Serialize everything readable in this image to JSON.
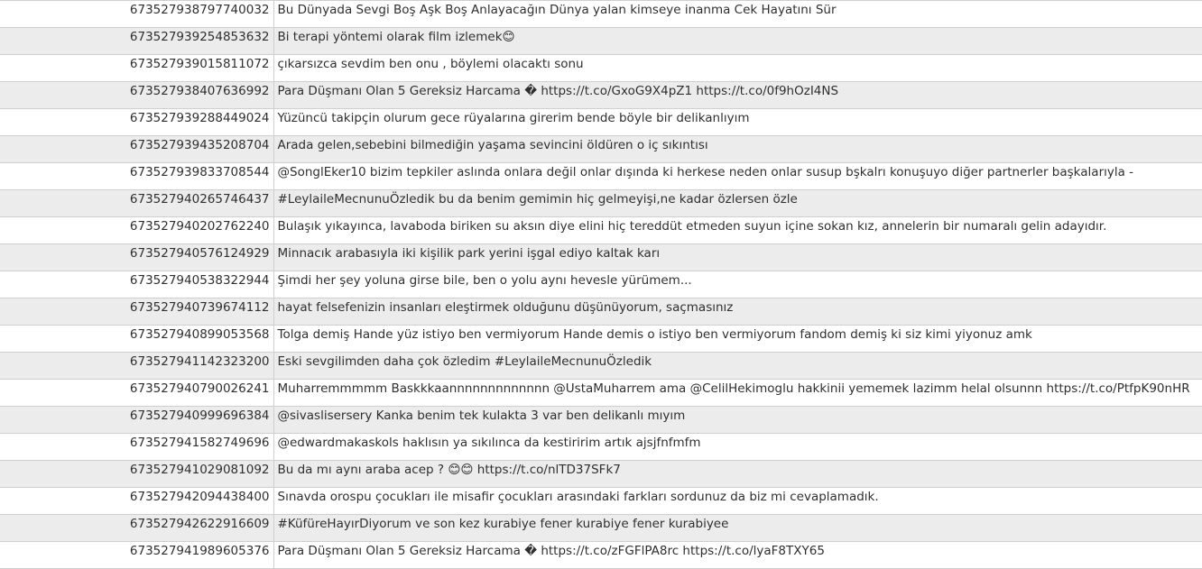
{
  "rows": [
    {
      "id": "673527938797740032",
      "text": "Bu Dünyada Sevgi Boş Aşk Boş Anlayacağın Dünya yalan kimseye inanma Cek Hayatını Sür"
    },
    {
      "id": "673527939254853632",
      "text": "Bi terapi yöntemi olarak film izlemek😊"
    },
    {
      "id": "673527939015811072",
      "text": "çıkarsızca sevdim ben onu , böylemi olacaktı sonu"
    },
    {
      "id": "673527938407636992",
      "text": "Para Düşmanı Olan 5 Gereksiz Harcama  � https://t.co/GxoG9X4pZ1 https://t.co/0f9hOzI4NS"
    },
    {
      "id": "673527939288449024",
      "text": "Yüzüncü takipçin olurum gece rüyalarına girerim  bende böyle bir delikanlıyım"
    },
    {
      "id": "673527939435208704",
      "text": "Arada gelen,sebebini bilmediğin yaşama sevincini öldüren o iç sıkıntısı"
    },
    {
      "id": "673527939833708544",
      "text": "@SonglEker10 bizim tepkiler aslında onlara değil onlar dışında ki herkese neden onlar susup bşkalrı konuşuyo diğer partnerler başkalarıyla -"
    },
    {
      "id": "673527940265746437",
      "text": "#LeylaileMecnunuÖzledik bu da benim gemimin hiç gelmeyişi,ne kadar özlersen özle"
    },
    {
      "id": "673527940202762240",
      "text": "Bulaşık yıkayınca, lavaboda biriken su aksın diye elini hiç tereddüt etmeden suyun içine sokan kız, annelerin bir numaralı gelin adayıdır."
    },
    {
      "id": "673527940576124929",
      "text": "Minnacık arabasıyla iki kişilik park yerini işgal ediyo kaltak karı"
    },
    {
      "id": "673527940538322944",
      "text": "Şimdi her şey yoluna girse bile, ben o yolu aynı hevesle yürümem..."
    },
    {
      "id": "673527940739674112",
      "text": "hayat felsefenizin insanları eleştirmek olduğunu düşünüyorum, saçmasınız"
    },
    {
      "id": "673527940899053568",
      "text": "Tolga demiş Hande yüz istiyo ben vermiyorum Hande demis o istiyo ben vermiyorum fandom demiş ki siz kimi yiyonuz amk"
    },
    {
      "id": "673527941142323200",
      "text": "Eski sevgilimden daha çok özledim #LeylaileMecnunuÖzledik"
    },
    {
      "id": "673527940790026241",
      "text": "Muharremmmmm Baskkkaannnnnnnnnnnnn @UstaMuharrem   ama @CelilHekimoglu  hakkinii yememek lazimm helal olsunnn https://t.co/PtfpK90nHR"
    },
    {
      "id": "673527940999696384",
      "text": "@sivaslisersery Kanka benim tek kulakta 3 var ben delikanlı mıyım"
    },
    {
      "id": "673527941582749696",
      "text": "@edwardmakaskols haklısın ya sıkılınca da kestiririm artık ajsjfnfmfm"
    },
    {
      "id": "673527941029081092",
      "text": "Bu da mı aynı araba acep ? 😊😊 https://t.co/nlTD37SFk7"
    },
    {
      "id": "673527942094438400",
      "text": "Sınavda orospu çocukları ile misafir çocukları arasındaki farkları sordunuz da biz mi cevaplamadık."
    },
    {
      "id": "673527942622916609",
      "text": "#KüfüreHayırDiyorum ve son kez kurabiye fener kurabiye fener kurabiyee"
    },
    {
      "id": "673527941989605376",
      "text": "Para Düşmanı Olan 5 Gereksiz Harcama  � https://t.co/zFGFlPA8rc https://t.co/lyaF8TXY65"
    }
  ]
}
